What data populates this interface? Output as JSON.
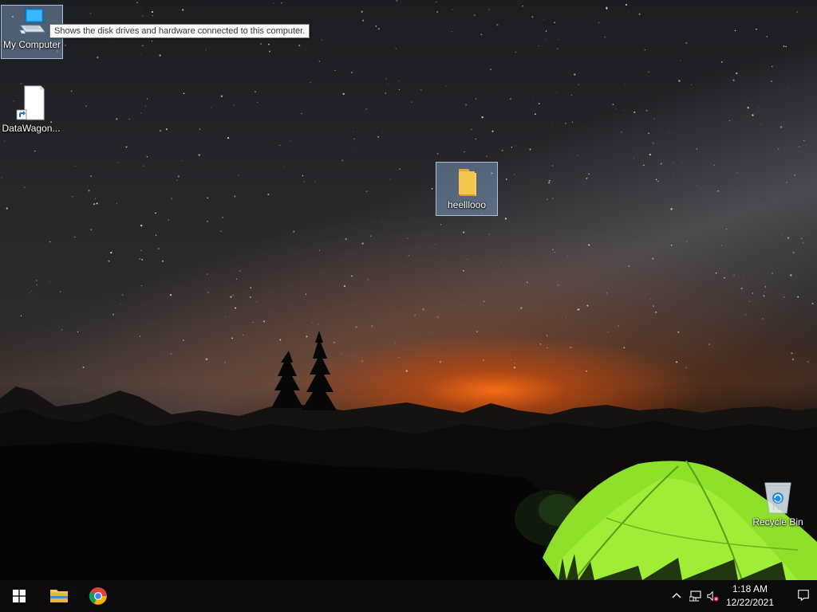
{
  "desktop": {
    "icons": {
      "my_computer": {
        "label": "My Computer"
      },
      "datawagon": {
        "label": "DataWagon..."
      },
      "folder": {
        "label": "heelllooo"
      },
      "recycle_bin": {
        "label": "Recycle Bin"
      }
    },
    "tooltip": "Shows the disk drives and hardware connected to this computer."
  },
  "taskbar": {
    "start_icon": "windows-logo-icon",
    "pinned": [
      "file-explorer-icon",
      "chrome-icon"
    ],
    "tray": {
      "icons": [
        "chevron-up-icon",
        "network-icon",
        "volume-muted-icon"
      ],
      "time": "1:18 AM",
      "date": "12/22/2021",
      "notification_icon": "action-center-icon"
    }
  },
  "colors": {
    "taskbar_bg": "#0b0b0c",
    "tent_green": "#8ee02a",
    "folder_yellow": "#f3c64f",
    "selection": "#8cafd7"
  }
}
